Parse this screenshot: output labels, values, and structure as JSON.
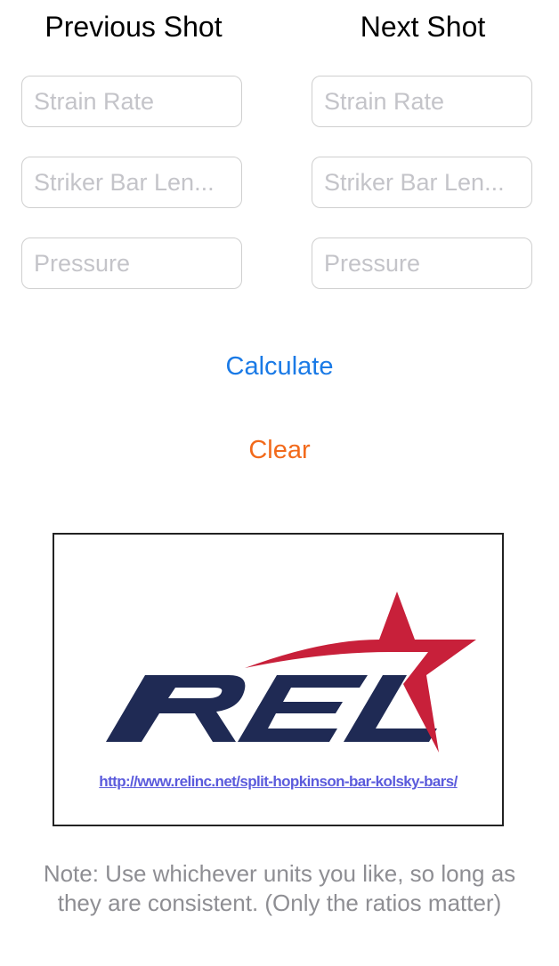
{
  "columns": {
    "left_title": "Previous Shot",
    "right_title": "Next Shot"
  },
  "left_fields": {
    "strain_rate_placeholder": "Strain Rate",
    "striker_bar_length_placeholder": "Striker Bar Len...",
    "pressure_placeholder": "Pressure",
    "strain_rate_value": "",
    "striker_bar_length_value": "",
    "pressure_value": ""
  },
  "right_fields": {
    "strain_rate_placeholder": "Strain Rate",
    "striker_bar_length_placeholder": "Striker Bar Len...",
    "pressure_placeholder": "Pressure",
    "strain_rate_value": "",
    "striker_bar_length_value": "",
    "pressure_value": ""
  },
  "actions": {
    "calculate_label": "Calculate",
    "clear_label": "Clear"
  },
  "logo": {
    "wordmark": "REL",
    "link_text": "http://www.relinc.net/split-hopkinson-bar-kolsky-bars/"
  },
  "note": "Note: Use whichever units you like, so long as they are consistent. (Only the ratios matter)",
  "colors": {
    "calculate": "#1a7ae6",
    "clear": "#f26a1b",
    "logo_navy": "#1f2a54",
    "logo_red": "#c8203a",
    "link": "#5b5bdc"
  }
}
